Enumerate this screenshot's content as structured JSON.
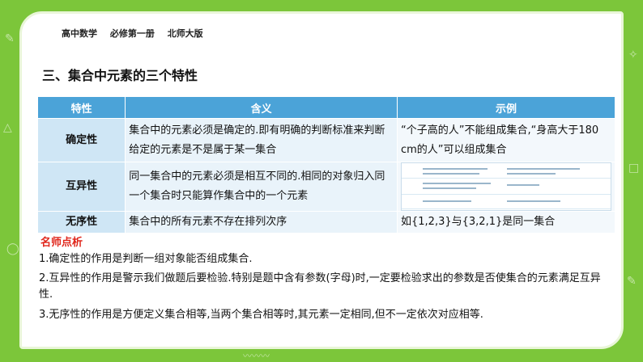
{
  "header": {
    "subject": "高中数学",
    "book": "必修第一册",
    "edition": "北师大版"
  },
  "title": "三、集合中元素的三个特性",
  "table": {
    "headers": [
      "特性",
      "含义",
      "示例"
    ],
    "rows": [
      {
        "name": "确定性",
        "meaning": "集合中的元素必须是确定的.即有明确的判断标准来判断给定的元素是不是属于某一集合",
        "example": "“个子高的人”不能组成集合,“身高大于180 cm的人”可以组成集合"
      },
      {
        "name": "互异性",
        "meaning": "同一集合中的元素必须是相互不同的.相同的对象归入同一个集合时只能算作集合中的一个元素",
        "example": ""
      },
      {
        "name": "无序性",
        "meaning": "集合中的所有元素不存在排列次序",
        "example": "如{1,2,3}与{3,2,1}是同一集合"
      }
    ]
  },
  "notes": {
    "title": "名师点析",
    "items": [
      "1.确定性的作用是判断一组对象能否组成集合.",
      "2.互异性的作用是警示我们做题后要检验.特别是题中含有参数(字母)时,一定要检验求出的参数是否使集合的元素满足互异性.",
      "3.无序性的作用是方便定义集合相等,当两个集合相等时,其元素一定相同,但不一定依次对应相等."
    ]
  }
}
